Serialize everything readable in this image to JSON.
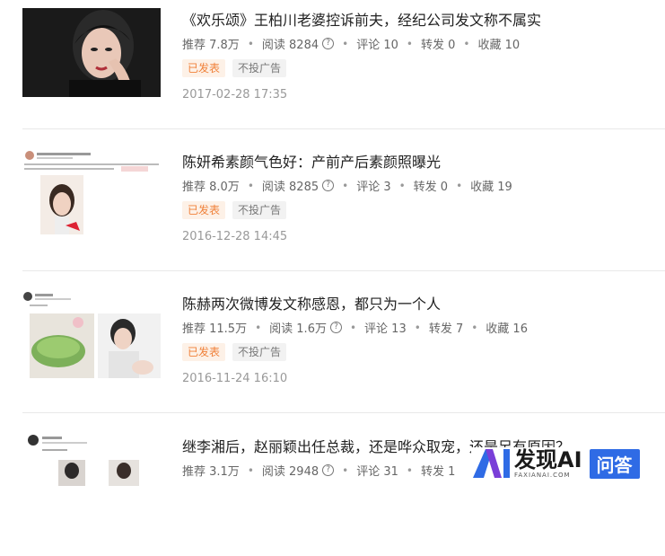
{
  "articles": [
    {
      "title": "《欢乐颂》王柏川老婆控诉前夫，经纪公司发文称不属实",
      "recommend": "推荐 7.8万",
      "reads": "阅读 8284",
      "comments": "评论 10",
      "shares": "转发 0",
      "favorites": "收藏 10",
      "status_tag": "已发表",
      "ad_tag": "不投广告",
      "date": "2017-02-28 17:35"
    },
    {
      "title": "陈妍希素颜气色好：产前产后素颜照曝光",
      "recommend": "推荐 8.0万",
      "reads": "阅读 8285",
      "comments": "评论 3",
      "shares": "转发 0",
      "favorites": "收藏 19",
      "status_tag": "已发表",
      "ad_tag": "不投广告",
      "date": "2016-12-28 14:45"
    },
    {
      "title": "陈赫两次微博发文称感恩，都只为一个人",
      "recommend": "推荐 11.5万",
      "reads": "阅读 1.6万",
      "comments": "评论 13",
      "shares": "转发 7",
      "favorites": "收藏 16",
      "status_tag": "已发表",
      "ad_tag": "不投广告",
      "date": "2016-11-24 16:10"
    },
    {
      "title": "继李湘后，赵丽颖出任总裁，还是哗众取宠，还是另有原因？",
      "recommend": "推荐 3.1万",
      "reads": "阅读 2948",
      "comments": "评论 31",
      "shares": "转发 1"
    }
  ],
  "watermark": {
    "brand": "发现AI",
    "domain": "FAXIANAI.COM",
    "qa": "问答"
  },
  "colors": {
    "tag_published": "#f0813a",
    "watermark_blue": "#2f6be5"
  }
}
